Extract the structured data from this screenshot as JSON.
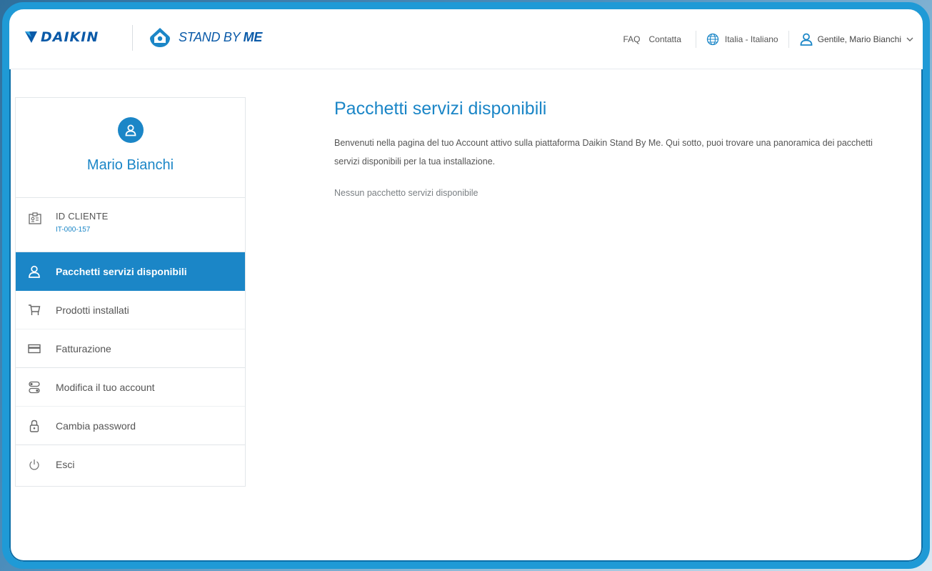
{
  "header": {
    "brand": "DAIKIN",
    "product_light": "STAND BY ",
    "product_bold": "ME",
    "links": {
      "faq": "FAQ",
      "contact": "Contatta"
    },
    "language": "Italia - Italiano",
    "user_greeting": "Gentile, Mario Bianchi"
  },
  "sidebar": {
    "profile_name": "Mario Bianchi",
    "client_label": "ID CLIENTE",
    "client_id": "IT-000-157",
    "items": [
      {
        "label": "Pacchetti servizi disponibili",
        "icon": "user-icon",
        "active": true
      },
      {
        "label": "Prodotti installati",
        "icon": "cart-icon"
      },
      {
        "label": "Fatturazione",
        "icon": "credit-card-icon"
      },
      {
        "label": "Modifica il tuo account",
        "icon": "settings-toggle-icon"
      },
      {
        "label": "Cambia password",
        "icon": "lock-icon"
      },
      {
        "label": "Esci",
        "icon": "power-icon"
      }
    ]
  },
  "main": {
    "title": "Pacchetti servizi disponibili",
    "intro": "Benvenuti nella pagina del tuo Account attivo sulla piattaforma Daikin Stand By Me. Qui sotto, puoi trovare una panoramica dei pacchetti servizi disponibili per la tua installazione.",
    "empty_message": "Nessun pacchetto servizi disponibile"
  },
  "colors": {
    "accent": "#1b86c7",
    "brand_blue": "#0a5aa8",
    "frame": "#1f9ad6"
  }
}
